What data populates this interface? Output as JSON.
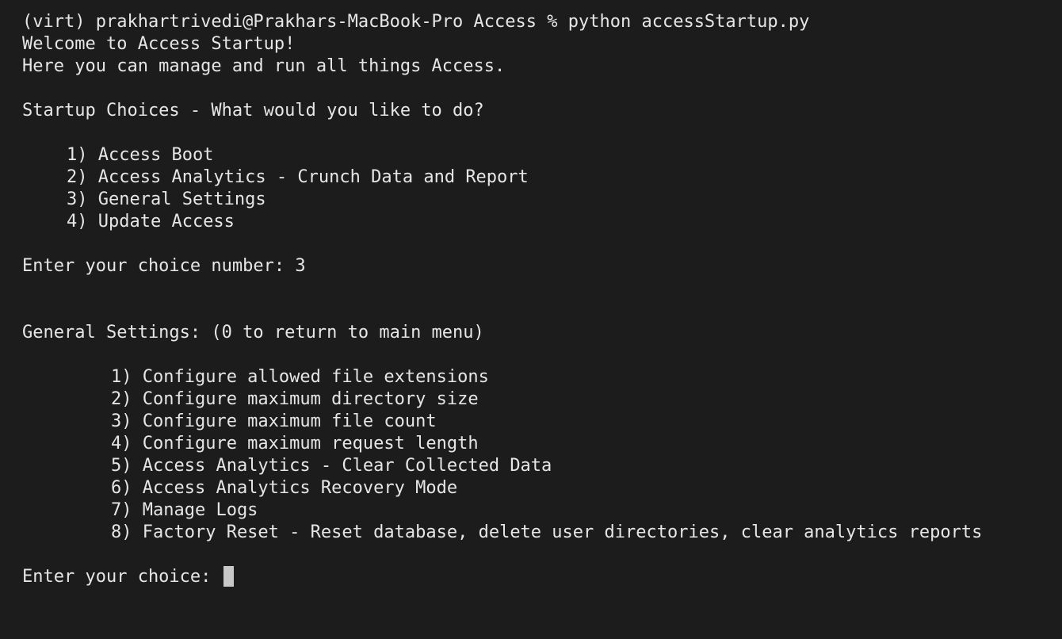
{
  "prompt_line": "(virt) prakhartrivedi@Prakhars-MacBook-Pro Access % python accessStartup.py",
  "welcome": "Welcome to Access Startup!",
  "intro": "Here you can manage and run all things Access.",
  "startup_heading": "Startup Choices - What would you like to do?",
  "startup_options": [
    "1) Access Boot",
    "2) Access Analytics - Crunch Data and Report",
    "3) General Settings",
    "4) Update Access"
  ],
  "choice_prompt": "Enter your choice number: 3",
  "settings_heading": "General Settings: (0 to return to main menu)",
  "settings_options": [
    "1) Configure allowed file extensions",
    "2) Configure maximum directory size",
    "3) Configure maximum file count",
    "4) Configure maximum request length",
    "5) Access Analytics - Clear Collected Data",
    "6) Access Analytics Recovery Mode",
    "7) Manage Logs",
    "8) Factory Reset - Reset database, delete user directories, clear analytics reports"
  ],
  "input_prompt": "Enter your choice: ",
  "colors": {
    "background": "#1c1c1c",
    "text": "#e6e6e6",
    "cursor": "#c8c8c8"
  }
}
